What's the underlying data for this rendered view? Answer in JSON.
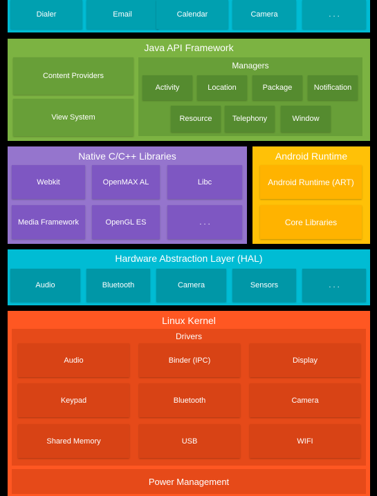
{
  "applications": {
    "items": [
      "Dialer",
      "Email",
      "Calendar",
      "Camera",
      ". . ."
    ]
  },
  "java_api": {
    "title": "Java API Framework",
    "content_providers": "Content Providers",
    "view_system": "View System",
    "managers_title": "Managers",
    "managers_row1": [
      "Activity",
      "Location",
      "Package",
      "Notification"
    ],
    "managers_row2": [
      "Resource",
      "Telephony",
      "Window"
    ]
  },
  "native_libs": {
    "title": "Native C/C++ Libraries",
    "items": [
      "Webkit",
      "OpenMAX AL",
      "Libc",
      "Media Framework",
      "OpenGL ES",
      ". . ."
    ]
  },
  "android_runtime": {
    "title": "Android Runtime",
    "items": [
      "Android Runtime (ART)",
      "Core Libraries"
    ]
  },
  "hal": {
    "title": "Hardware Abstraction Layer (HAL)",
    "items": [
      "Audio",
      "Bluetooth",
      "Camera",
      "Sensors",
      ". . ."
    ]
  },
  "linux_kernel": {
    "title": "Linux Kernel",
    "drivers_title": "Drivers",
    "drivers": [
      "Audio",
      "Binder (IPC)",
      "Display",
      "Keypad",
      "Bluetooth",
      "Camera",
      "Shared Memory",
      "USB",
      "WIFI"
    ],
    "power": "Power Management"
  },
  "colors": {
    "applications": "#00bcd4",
    "java_api": "#7cb342",
    "native_libs": "#9575cd",
    "android_runtime": "#ffc107",
    "hal": "#00bcd4",
    "linux_kernel": "#ff5722"
  }
}
